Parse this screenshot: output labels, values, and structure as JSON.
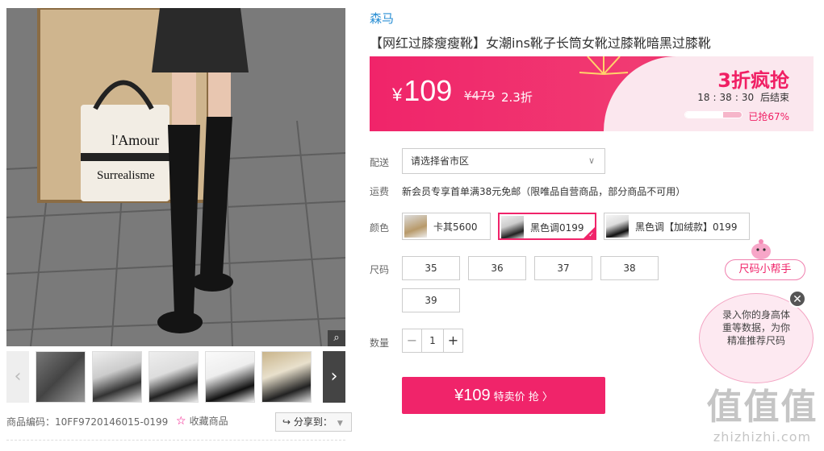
{
  "product": {
    "brand": "森马",
    "title": "【网红过膝瘦瘦靴】女潮ins靴子长筒女靴过膝靴暗黑过膝靴",
    "code_label": "商品编码：",
    "code": "10FF9720146015-0199",
    "favorite_label": "收藏商品",
    "share_label": "分享到："
  },
  "price": {
    "currency": "¥",
    "current": "109",
    "original": "¥479",
    "discount": "2.3折",
    "promo_title": "3折疯抢",
    "countdown": {
      "h": "18",
      "m": "38",
      "s": "30",
      "suffix": "后结束"
    },
    "sold_text": "已抢67%",
    "sold_fraction": 0.67
  },
  "delivery": {
    "label": "配送",
    "placeholder": "请选择省市区"
  },
  "shipping": {
    "label": "运费",
    "text": "新会员专享首单满38元免邮（限唯品自营商品，部分商品不可用）"
  },
  "colors": {
    "label": "颜色",
    "options": [
      {
        "name": "卡其5600",
        "selected": false
      },
      {
        "name": "黑色调0199",
        "selected": true
      },
      {
        "name": "黑色调【加绒款】0199",
        "selected": false
      }
    ]
  },
  "sizes": {
    "label": "尺码",
    "options": [
      "35",
      "36",
      "37",
      "38",
      "39"
    ]
  },
  "quantity": {
    "label": "数量",
    "value": "1",
    "minus": "−",
    "plus": "+"
  },
  "buy": {
    "price": "¥109",
    "label": "特卖价 抢 〉"
  },
  "helper": {
    "tag": "尺码小帮手",
    "line1": "录入你的身高体",
    "line2": "重等数据，为你",
    "line3": "精准推荐尺码",
    "close": "✕"
  },
  "photo": {
    "bag_text_1": "l'Amour",
    "bag_text_2": "Surrealisme"
  },
  "watermark": {
    "big": "值值值",
    "url": "zhizhizhi.com"
  },
  "colors_hex": {
    "accent": "#f0246a",
    "brand_link": "#2a8fd4"
  }
}
